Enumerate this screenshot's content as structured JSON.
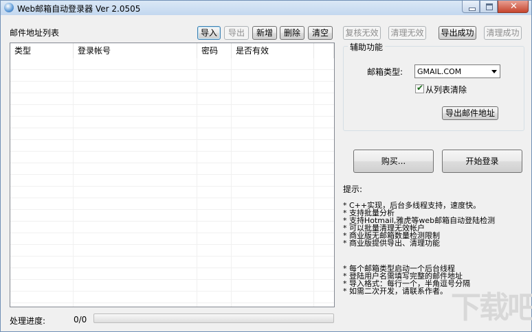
{
  "window": {
    "title": "Web邮箱自动登录器 Ver 2.0505"
  },
  "list": {
    "title": "邮件地址列表",
    "buttons": {
      "import": "导入",
      "export": "导出",
      "add": "新增",
      "delete": "删除",
      "clear": "清空"
    },
    "columns": [
      "类型",
      "登录帐号",
      "密码",
      "是否有效",
      ""
    ]
  },
  "right_buttons": {
    "recheck_invalid": "复核无效",
    "clean_invalid": "清理无效",
    "export_success": "导出成功",
    "clean_success": "清理成功"
  },
  "aux": {
    "title": "辅助功能",
    "mailbox_type_label": "邮箱类型:",
    "mailbox_type_value": "GMAIL.COM",
    "remove_from_list_label": "从列表清除",
    "remove_from_list_checked": true,
    "export_addresses": "导出邮件地址"
  },
  "actions": {
    "buy": "购买...",
    "start_login": "开始登录"
  },
  "tips": {
    "title": "提示:",
    "group1": [
      "* C++实现，后台多线程支持，速度快。",
      "* 支持批量分析",
      "* 支持Hotmail,雅虎等web邮箱自动登陆检测",
      "* 可以批量清理无效帐户",
      "* 商业版无邮箱数量检测限制",
      "* 商业版提供导出、清理功能"
    ],
    "group2": [
      "* 每个邮箱类型启动一个后台线程",
      "* 登陆用户名需填写完整的邮件地址",
      "* 导入格式：每行一个，半角逗号分隔",
      "* 如需二次开发，请联系作者。"
    ]
  },
  "status": {
    "progress_label": "处理进度:",
    "progress_count": "0/0",
    "progress_fraction": 0
  },
  "watermark": "下载吧"
}
